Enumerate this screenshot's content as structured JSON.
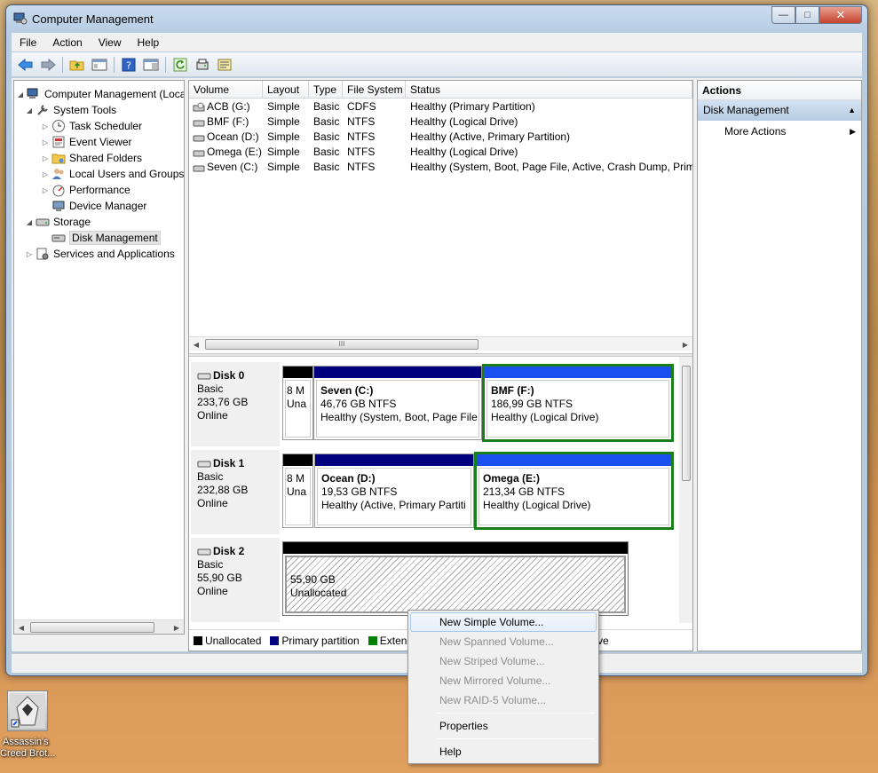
{
  "window": {
    "title": "Computer Management",
    "min": "—",
    "max": "□",
    "close": "✕"
  },
  "menu": [
    "File",
    "Action",
    "View",
    "Help"
  ],
  "tree": {
    "root": "Computer Management (Local",
    "system_tools": "System Tools",
    "task_scheduler": "Task Scheduler",
    "event_viewer": "Event Viewer",
    "shared_folders": "Shared Folders",
    "local_users": "Local Users and Groups",
    "performance": "Performance",
    "device_manager": "Device Manager",
    "storage": "Storage",
    "disk_management": "Disk Management",
    "services": "Services and Applications"
  },
  "volumes": {
    "columns": [
      "Volume",
      "Layout",
      "Type",
      "File System",
      "Status"
    ],
    "rows": [
      {
        "volume": "ACB (G:)",
        "layout": "Simple",
        "type": "Basic",
        "fs": "CDFS",
        "status": "Healthy (Primary Partition)"
      },
      {
        "volume": "BMF (F:)",
        "layout": "Simple",
        "type": "Basic",
        "fs": "NTFS",
        "status": "Healthy (Logical Drive)"
      },
      {
        "volume": "Ocean (D:)",
        "layout": "Simple",
        "type": "Basic",
        "fs": "NTFS",
        "status": "Healthy (Active, Primary Partition)"
      },
      {
        "volume": "Omega (E:)",
        "layout": "Simple",
        "type": "Basic",
        "fs": "NTFS",
        "status": "Healthy (Logical Drive)"
      },
      {
        "volume": "Seven (C:)",
        "layout": "Simple",
        "type": "Basic",
        "fs": "NTFS",
        "status": "Healthy (System, Boot, Page File, Active, Crash Dump, Prima"
      }
    ]
  },
  "disks": [
    {
      "name": "Disk 0",
      "type": "Basic",
      "size": "233,76 GB",
      "state": "Online",
      "small": {
        "l1": "8 M",
        "l2": "Una"
      },
      "p1": {
        "name": "Seven  (C:)",
        "size": "46,76 GB NTFS",
        "status": "Healthy (System, Boot, Page File,"
      },
      "p2": {
        "name": "BMF  (F:)",
        "size": "186,99 GB NTFS",
        "status": "Healthy (Logical Drive)"
      }
    },
    {
      "name": "Disk 1",
      "type": "Basic",
      "size": "232,88 GB",
      "state": "Online",
      "small": {
        "l1": "8 M",
        "l2": "Una"
      },
      "p1": {
        "name": "Ocean  (D:)",
        "size": "19,53 GB NTFS",
        "status": "Healthy (Active, Primary Partiti"
      },
      "p2": {
        "name": "Omega  (E:)",
        "size": "213,34 GB NTFS",
        "status": "Healthy (Logical Drive)"
      }
    },
    {
      "name": "Disk 2",
      "type": "Basic",
      "size": "55,90 GB",
      "state": "Online",
      "p1": {
        "size": "55,90 GB",
        "status": "Unallocated"
      }
    }
  ],
  "legend": {
    "unallocated": "Unallocated",
    "primary": "Primary partition",
    "extended": "Extend",
    "tail": "ve",
    "colors": {
      "unallocated": "#000000",
      "primary": "#00007f",
      "extended": "#008000"
    }
  },
  "actions": {
    "header": "Actions",
    "section": "Disk Management",
    "more": "More Actions"
  },
  "context_menu": {
    "new_simple": "New Simple Volume...",
    "new_spanned": "New Spanned Volume...",
    "new_striped": "New Striped Volume...",
    "new_mirrored": "New Mirrored Volume...",
    "new_raid5": "New RAID-5 Volume...",
    "properties": "Properties",
    "help": "Help"
  },
  "desktop": {
    "line1": "Assassin's",
    "line2": "Creed Brot..."
  },
  "scroll_arrow_left": "◀",
  "scroll_arrow_right": "▶",
  "scroll_grip": "III",
  "chevron_right": "▶",
  "chevron_up": "▲"
}
